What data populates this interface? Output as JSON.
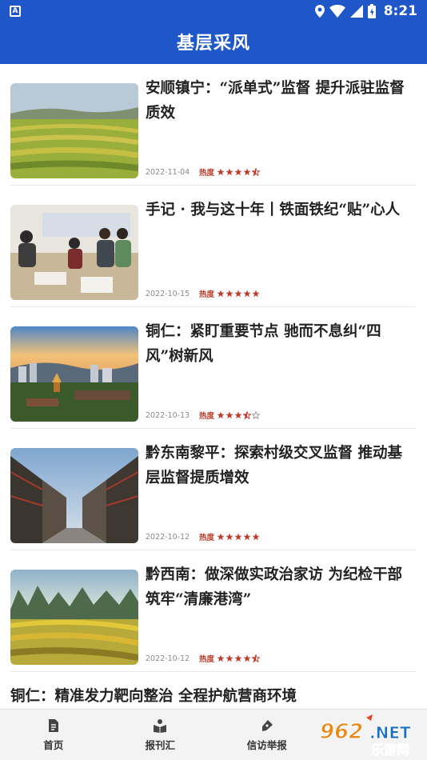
{
  "status_bar": {
    "time": "8:21",
    "app_badge": "A",
    "icons": [
      "location-icon",
      "wifi-icon",
      "signal-icon",
      "battery-icon"
    ]
  },
  "header": {
    "title": "基层采风"
  },
  "articles": [
    {
      "title": "安顺镇宁：“派单式”监督 提升派驻监督质效",
      "date": "2022-11-04",
      "heat_label": "热度",
      "heat_level": 4.5
    },
    {
      "title": "手记 · 我与这十年丨铁面铁纪“贴”心人",
      "date": "2022-10-15",
      "heat_label": "热度",
      "heat_level": 5
    },
    {
      "title": "铜仁：紧盯重要节点 驰而不息纠“四风”树新风",
      "date": "2022-10-13",
      "heat_label": "热度",
      "heat_level": 3.5
    },
    {
      "title": "黔东南黎平：探索村级交叉监督 推动基层监督提质增效",
      "date": "2022-10-12",
      "heat_label": "热度",
      "heat_level": 5
    },
    {
      "title": "黔西南：做深做实政治家访 为纪检干部筑牢“清廉港湾”",
      "date": "2022-10-12",
      "heat_label": "热度",
      "heat_level": 4.5
    },
    {
      "title": "铜仁：精准发力靶向整治 全程护航营商环境",
      "date": "",
      "heat_label": "",
      "heat_level": null
    }
  ],
  "tabbar": {
    "tabs": [
      {
        "label": "首页",
        "icon": "document-icon"
      },
      {
        "label": "报刊汇",
        "icon": "book-reader-icon"
      },
      {
        "label": "信访举报",
        "icon": "pen-icon"
      },
      {
        "label": "",
        "icon": ""
      }
    ]
  },
  "watermark": {
    "text_top": "962.NET",
    "text_bottom": "乐游网"
  },
  "colors": {
    "brand": "#1f57c8",
    "heat": "#c0392b"
  }
}
